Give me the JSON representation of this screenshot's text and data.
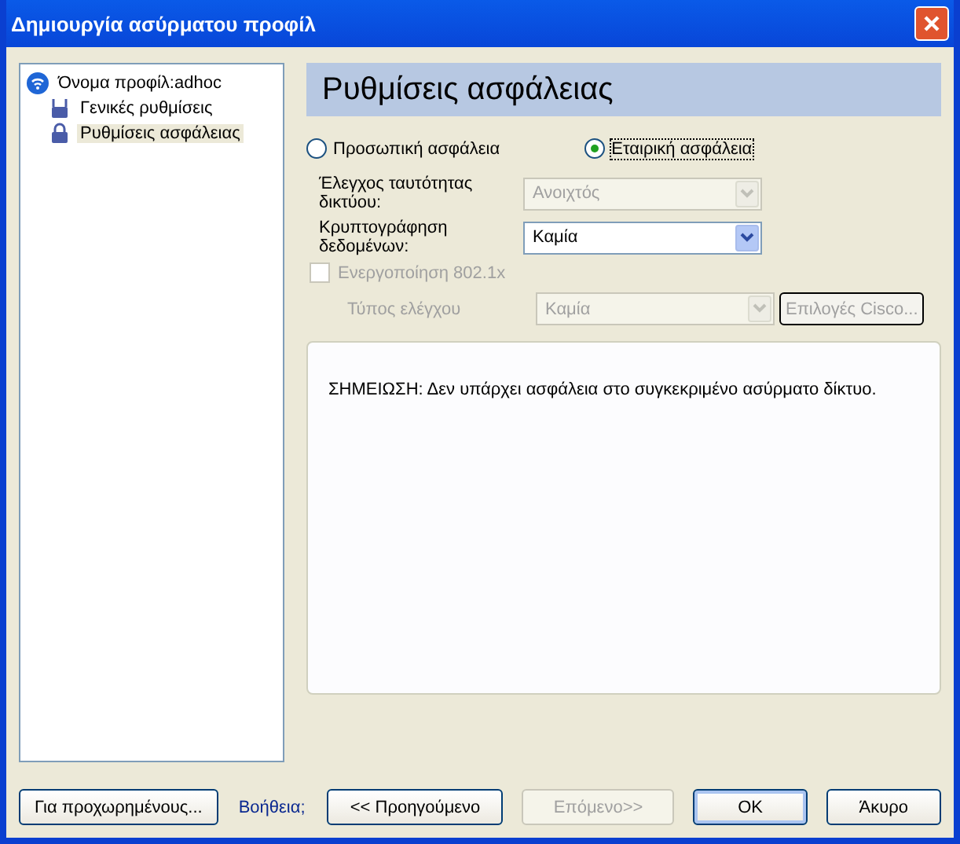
{
  "window": {
    "title": "Δημιουργία ασύρματου προφίλ"
  },
  "tree": {
    "label": "Όνομα προφίλ:adhoc",
    "children": [
      {
        "label": "Γενικές ρυθμίσεις",
        "selected": false
      },
      {
        "label": "Ρυθμίσεις ασφάλειας",
        "selected": true
      }
    ]
  },
  "heading": "Ρυθμίσεις ασφάλειας",
  "radios": [
    {
      "label": "Προσωπική ασφάλεια",
      "selected": false
    },
    {
      "label": "Εταιρική ασφάλεια",
      "selected": true
    }
  ],
  "fields": [
    {
      "label": "Έλεγχος ταυτότητας δικτύου:",
      "value": "Ανοιχτός",
      "disabled": true
    },
    {
      "label": "Κρυπτογράφηση δεδομένων:",
      "value": "Καμία",
      "disabled": false
    }
  ],
  "checkbox": {
    "label": "Ενεργοποίηση 802.1x",
    "checked": false,
    "disabled": true
  },
  "auth_type": {
    "label": "Τύπος ελέγχου",
    "value": "Καμία",
    "disabled": true
  },
  "cisco_button": {
    "label": "Επιλογές Cisco...",
    "disabled": true
  },
  "note": "ΣΗΜΕΙΩΣΗ: Δεν υπάρχει ασφάλεια στο συγκεκριμένο ασύρματο δίκτυο.",
  "footer": {
    "advanced": "Για προχωρημένους...",
    "help": "Βοήθεια;",
    "buttons": [
      {
        "label": "<< Προηγούμενο",
        "disabled": false,
        "default": false
      },
      {
        "label": "Επόμενο>>",
        "disabled": true,
        "default": false
      },
      {
        "label": "OK",
        "disabled": false,
        "default": true
      },
      {
        "label": "Άκυρο",
        "disabled": false,
        "default": false
      }
    ]
  }
}
